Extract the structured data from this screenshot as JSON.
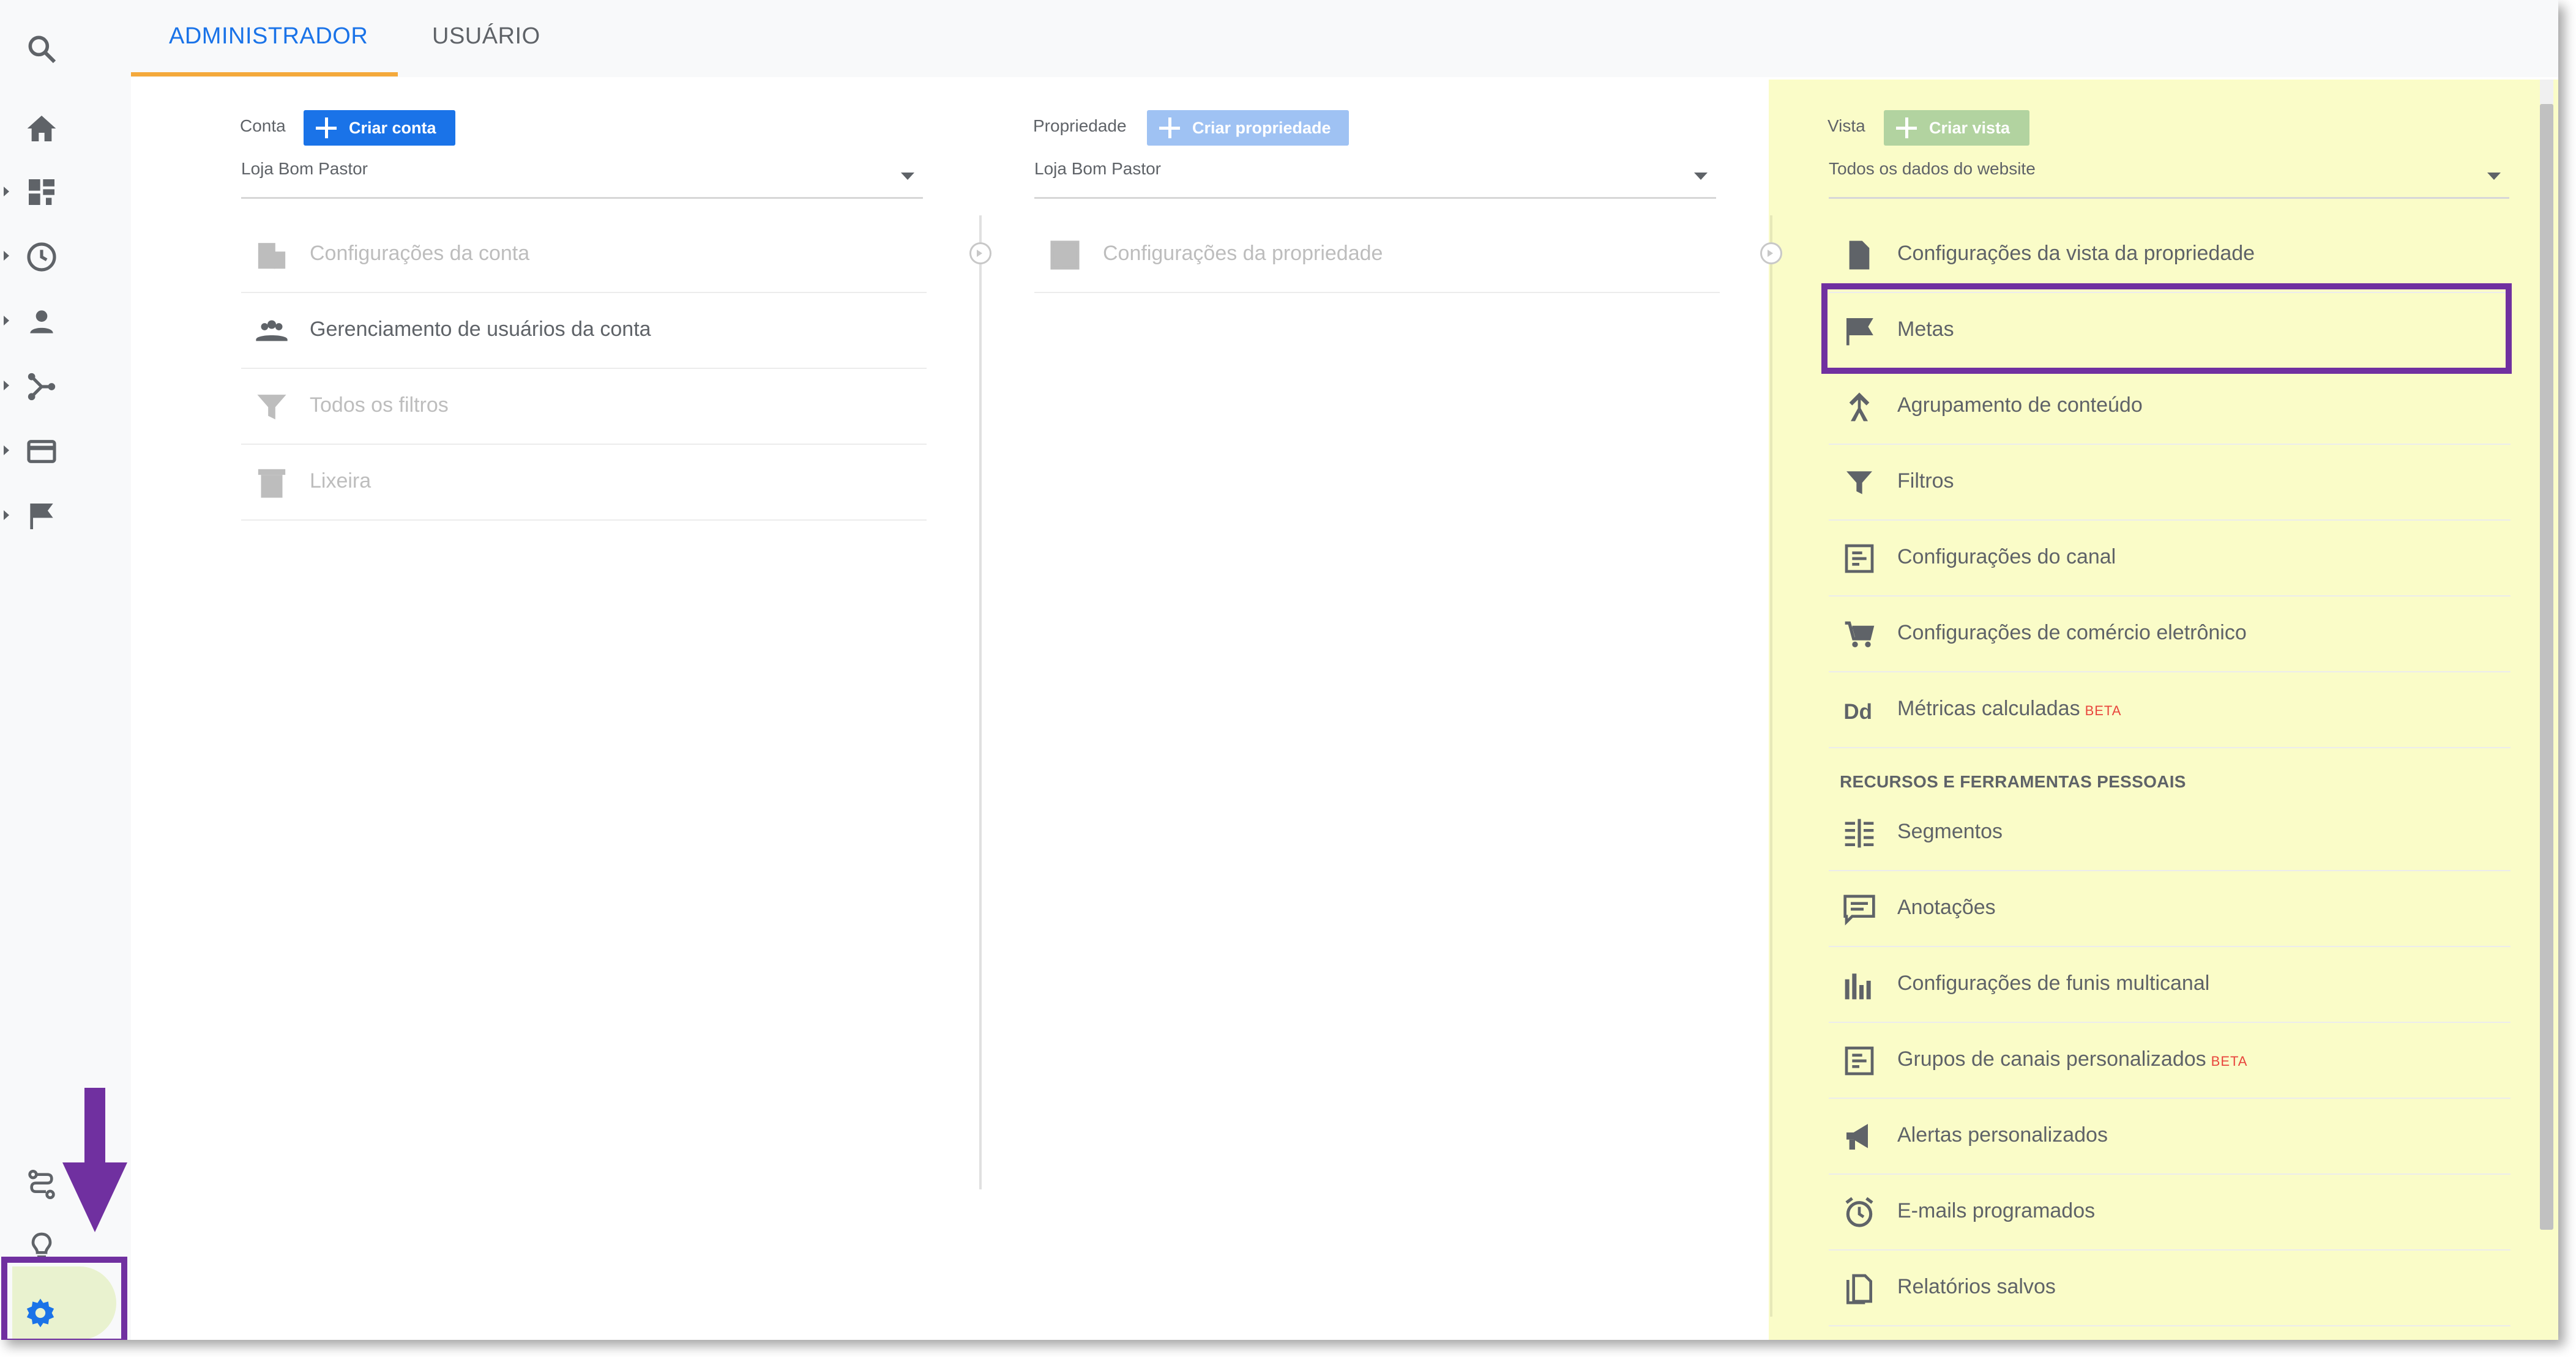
{
  "tabs": [
    {
      "label": "ADMINISTRADOR",
      "active": true
    },
    {
      "label": "USUÁRIO",
      "active": false
    }
  ],
  "left_nav": {
    "top_icons": [
      "search-icon",
      "home-icon",
      "dashboard-icon",
      "clock-icon",
      "person-icon",
      "acquisition-icon",
      "behavior-icon",
      "flag-icon"
    ],
    "bottom_icons": [
      "attribution-icon",
      "lightbulb-icon",
      "gear-icon"
    ]
  },
  "account_column": {
    "label": "Conta",
    "create_button": "Criar conta",
    "select_value": "Loja Bom Pastor",
    "items": [
      {
        "icon": "building-icon",
        "label": "Configurações da conta",
        "disabled": true
      },
      {
        "icon": "users-icon",
        "label": "Gerenciamento de usuários da conta",
        "disabled": false
      },
      {
        "icon": "filter-icon",
        "label": "Todos os filtros",
        "disabled": true
      },
      {
        "icon": "trash-icon",
        "label": "Lixeira",
        "disabled": true
      }
    ]
  },
  "property_column": {
    "label": "Propriedade",
    "create_button": "Criar propriedade",
    "select_value": "Loja Bom Pastor",
    "items": [
      {
        "icon": "layout-icon",
        "label": "Configurações da propriedade",
        "disabled": true
      }
    ]
  },
  "view_column": {
    "label": "Vista",
    "create_button": "Criar vista",
    "select_value": "Todos os dados do website",
    "items": [
      {
        "icon": "document-icon",
        "label": "Configurações da vista da propriedade"
      },
      {
        "icon": "flag-icon",
        "label": "Metas"
      },
      {
        "icon": "content-grouping-icon",
        "label": "Agrupamento de conteúdo"
      },
      {
        "icon": "filter-icon",
        "label": "Filtros"
      },
      {
        "icon": "channel-settings-icon",
        "label": "Configurações do canal"
      },
      {
        "icon": "cart-icon",
        "label": "Configurações de comércio eletrônico"
      },
      {
        "icon": "dd-icon",
        "label": "Métricas calculadas",
        "badge": "BETA"
      }
    ],
    "section_title": "RECURSOS E FERRAMENTAS PESSOAIS",
    "personal_items": [
      {
        "icon": "segments-icon",
        "label": "Segmentos"
      },
      {
        "icon": "comment-icon",
        "label": "Anotações"
      },
      {
        "icon": "bar-chart-icon",
        "label": "Configurações de funis multicanal"
      },
      {
        "icon": "channel-groups-icon",
        "label": "Grupos de canais personalizados",
        "badge": "BETA"
      },
      {
        "icon": "megaphone-icon",
        "label": "Alertas personalizados"
      },
      {
        "icon": "alarm-icon",
        "label": "E-mails programados"
      },
      {
        "icon": "copy-icon",
        "label": "Relatórios salvos"
      }
    ]
  },
  "colors": {
    "accent": "#1a73e8",
    "tab_underline": "#f4a93b",
    "highlight_annotation": "#7030a0",
    "view_panel": "#fafcc8",
    "beta": "#e8453c"
  }
}
